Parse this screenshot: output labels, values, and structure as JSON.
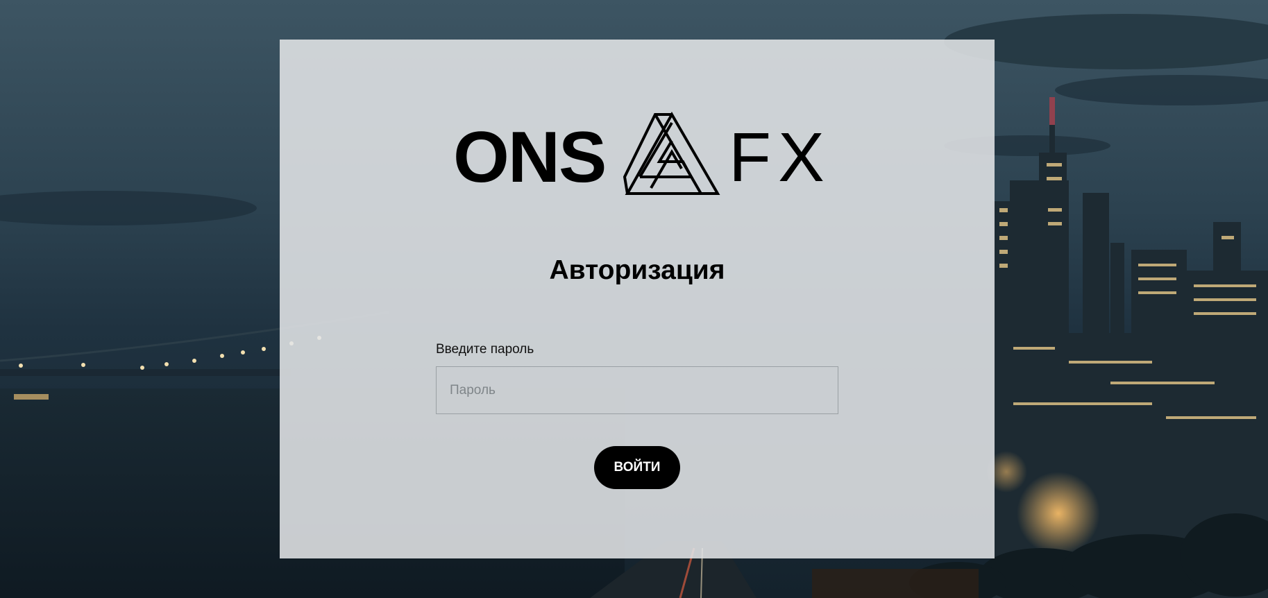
{
  "logo": {
    "left_text": "ONS",
    "right_text": "FX",
    "mark_icon": "impossible-triangle-icon"
  },
  "auth": {
    "title": "Авторизация",
    "password_label": "Введите пароль",
    "password_placeholder": "Пароль",
    "password_value": "",
    "submit_label": "ВОЙТИ"
  },
  "colors": {
    "card_background": "#e2e5e7",
    "button_background": "#000000",
    "button_text": "#ffffff",
    "text": "#000000"
  },
  "background": {
    "scene": "night-city-skyline-with-bridge-and-river"
  }
}
